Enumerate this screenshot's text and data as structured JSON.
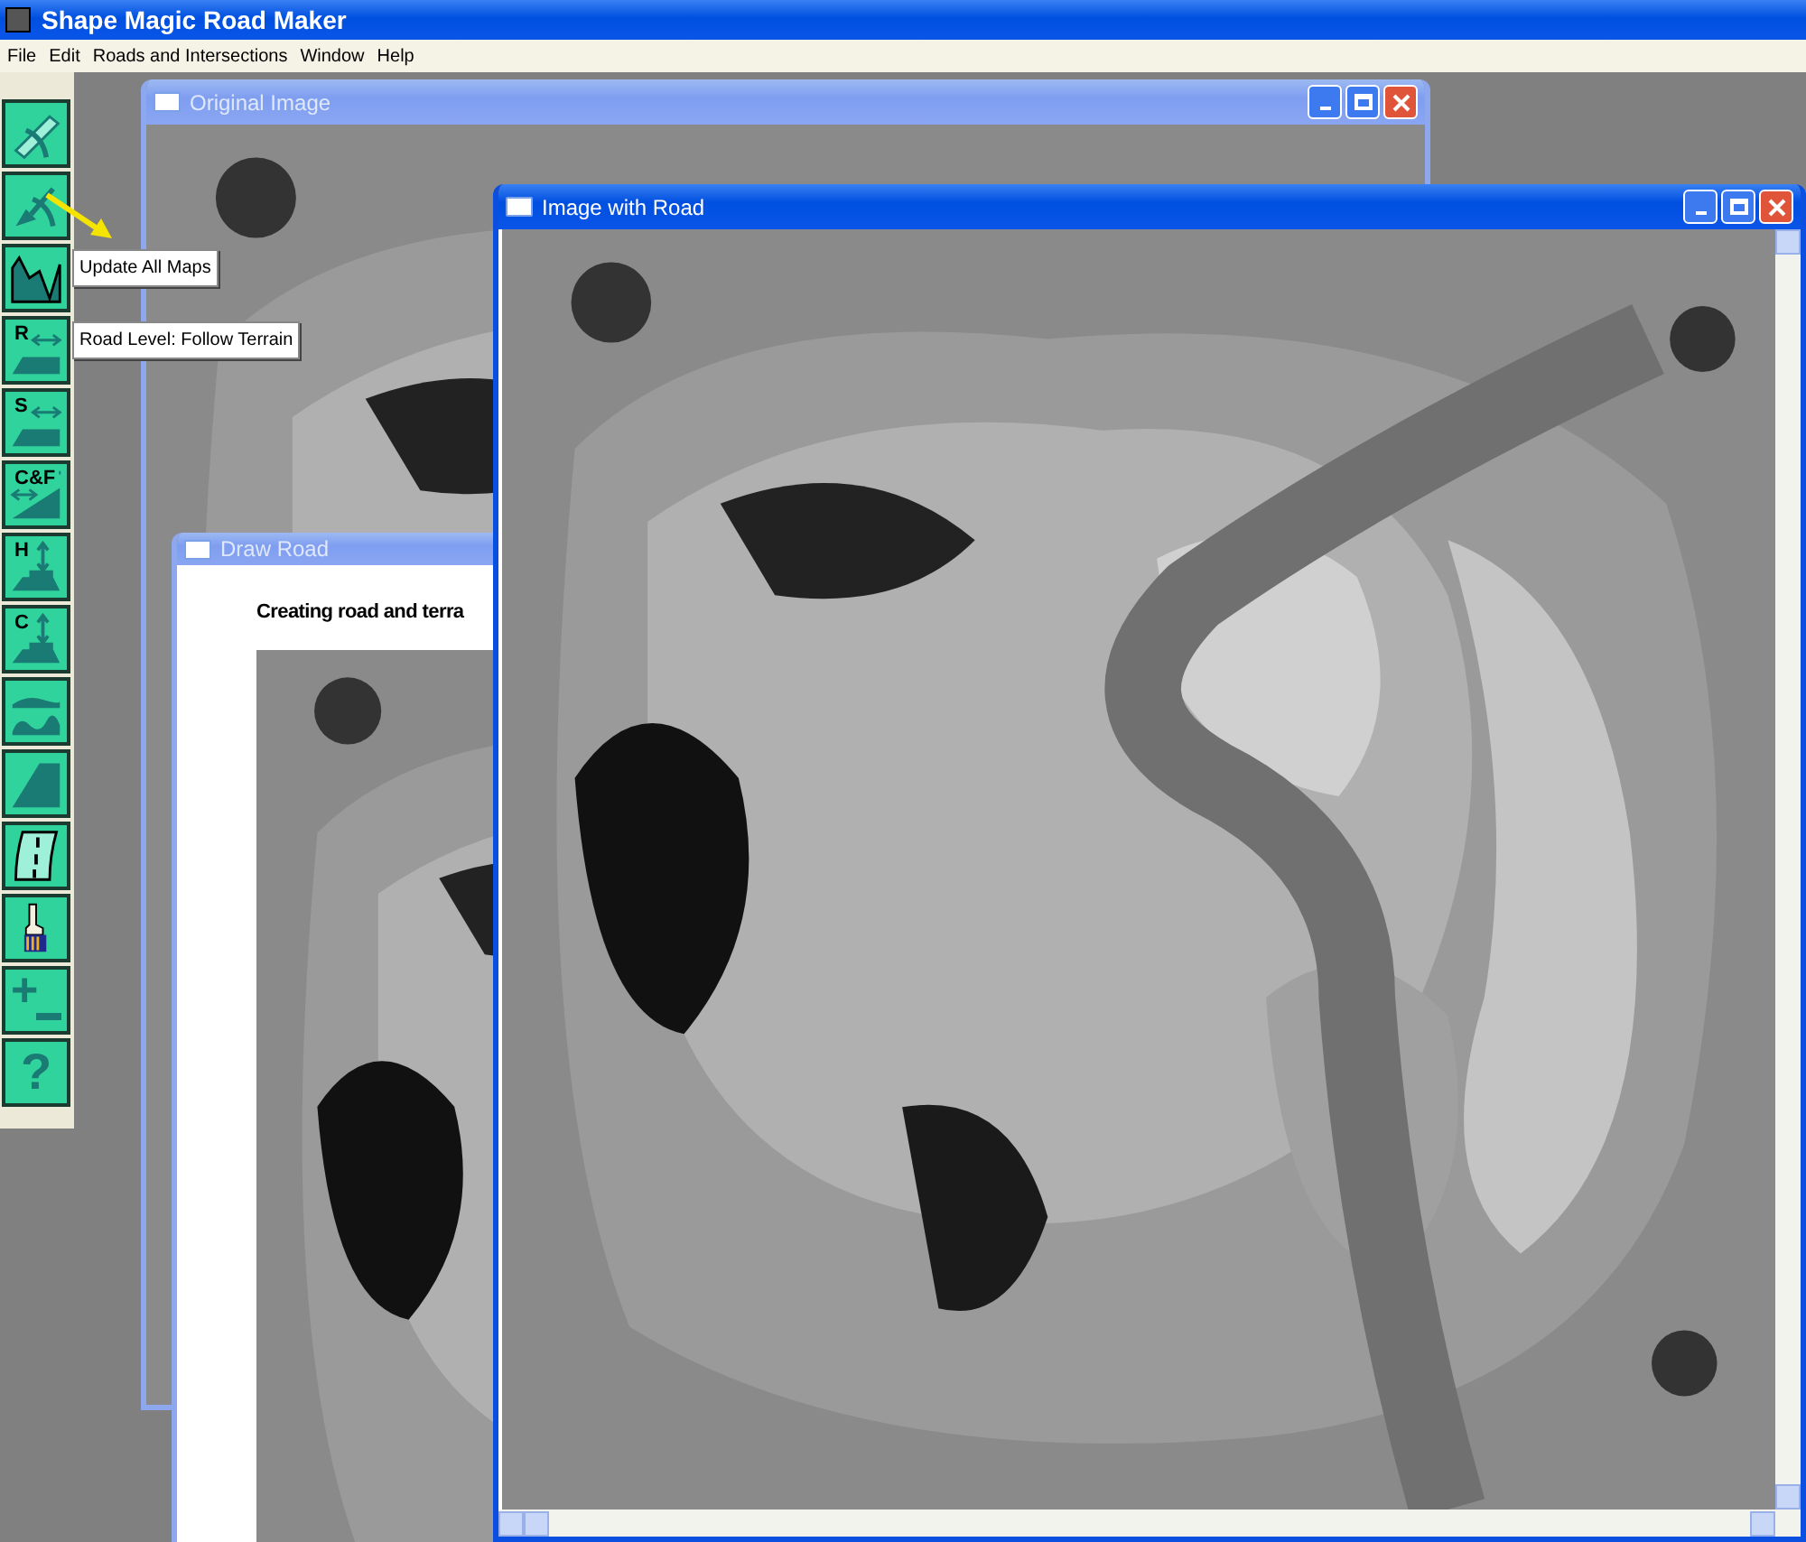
{
  "app": {
    "title": "Shape Magic Road Maker"
  },
  "menu": [
    "File",
    "Edit",
    "Roads and Intersections",
    "Window",
    "Help"
  ],
  "toolbar": [
    {
      "kind": "pickaxe"
    },
    {
      "kind": "shovel"
    },
    {
      "kind": "wave"
    },
    {
      "kind": "level",
      "label": "R"
    },
    {
      "kind": "level",
      "label": "S"
    },
    {
      "kind": "slope",
      "label": "C&F"
    },
    {
      "kind": "height",
      "label": "H"
    },
    {
      "kind": "height",
      "label": "C"
    },
    {
      "kind": "layers"
    },
    {
      "kind": "ramp"
    },
    {
      "kind": "road"
    },
    {
      "kind": "brush"
    },
    {
      "kind": "zoom",
      "label": "+"
    },
    {
      "kind": "help",
      "label": "?"
    }
  ],
  "tooltips": [
    "Update All Maps",
    "Road Level: Follow Terrain"
  ],
  "windows": [
    {
      "title": "Original Image",
      "active": false,
      "controls": true
    },
    {
      "title": "Draw Road",
      "active": false,
      "controls": false,
      "message": "Creating road and terra"
    },
    {
      "title": "Image with Road",
      "active": true,
      "controls": true,
      "scrollbars": true
    }
  ]
}
